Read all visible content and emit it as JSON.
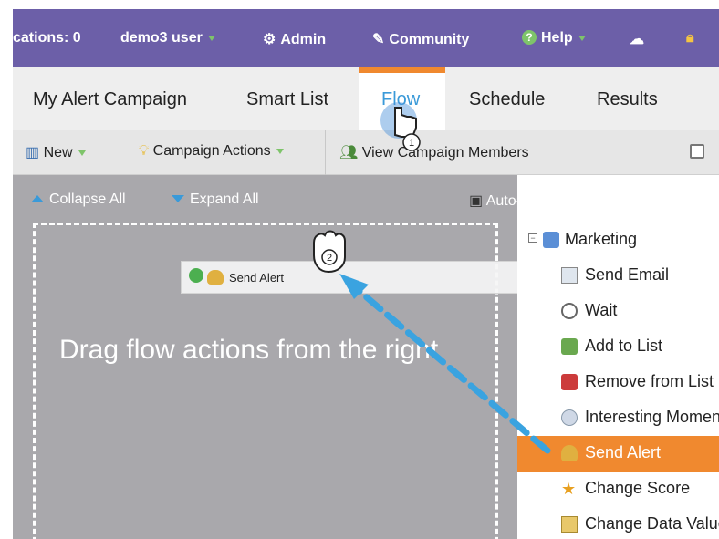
{
  "header": {
    "notifications": "cations: 0",
    "user": "demo3 user",
    "admin": "Admin",
    "community": "Community",
    "help": "Help",
    "accent": "#6c5fa8"
  },
  "tabs": {
    "campaign_name": "My Alert Campaign",
    "smart_list": "Smart List",
    "flow": "Flow",
    "schedule": "Schedule",
    "results": "Results",
    "active_color": "#f0892f"
  },
  "toolbar": {
    "new": "New",
    "campaign_actions": "Campaign Actions",
    "view_members": "View Campaign Members"
  },
  "canvas": {
    "collapse_all": "Collapse All",
    "expand_all": "Expand All",
    "autosave": "Auto-Save: no changes",
    "drop_hint": "Drag flow actions from the right",
    "dragged_item": "Send Alert"
  },
  "palette": {
    "group": "Marketing",
    "items": [
      {
        "label": "Send Email",
        "icon": "email-icon"
      },
      {
        "label": "Wait",
        "icon": "clock-icon"
      },
      {
        "label": "Add to List",
        "icon": "add-list-icon"
      },
      {
        "label": "Remove from List",
        "icon": "remove-list-icon"
      },
      {
        "label": "Interesting Moment",
        "icon": "speech-bubble-icon"
      },
      {
        "label": "Send Alert",
        "icon": "bell-icon"
      },
      {
        "label": "Change Score",
        "icon": "star-icon"
      },
      {
        "label": "Change Data Value",
        "icon": "data-value-icon"
      }
    ],
    "active_index": 5
  },
  "callouts": {
    "step1": "1",
    "step2": "2"
  }
}
